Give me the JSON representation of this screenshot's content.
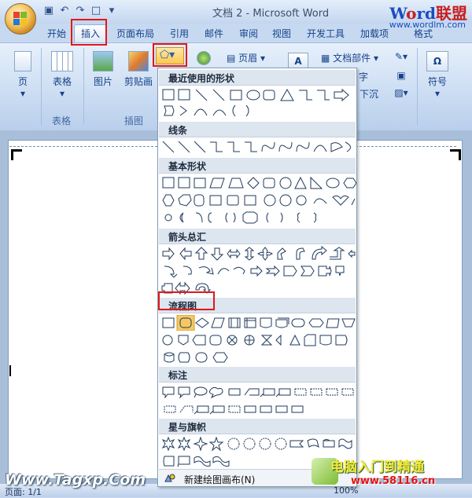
{
  "window": {
    "title": "文档 2 - Microsoft Word"
  },
  "qat": [
    "save-icon",
    "undo-icon",
    "redo-icon",
    "new-doc-icon",
    "customize-icon"
  ],
  "watermark_top": {
    "brand": "Word联盟",
    "brand_w": "W",
    "brand_o": "o",
    "brand_rd": "rd",
    "brand_cn": "联盟",
    "url": "www.wordlm.com"
  },
  "tabs": [
    "开始",
    "插入",
    "页面布局",
    "引用",
    "邮件",
    "审阅",
    "视图",
    "开发工具",
    "加载项",
    "格式"
  ],
  "ribbon": {
    "page_label": "页",
    "table_label": "表格",
    "table_group": "表格",
    "picture_label": "图片",
    "clipart_label": "剪贴画",
    "illus_group": "插图",
    "header_label": "页眉",
    "docparts_label": "文档部件",
    "char_label": "字",
    "sink_label": "下沉",
    "symbol_label": "符号"
  },
  "dropdown": {
    "sections": [
      "最近使用的形状",
      "线条",
      "基本形状",
      "箭头总汇",
      "流程图",
      "标注",
      "星与旗帜"
    ],
    "footer": "新建绘图画布(N)"
  },
  "status": {
    "page": "页面: 1/1",
    "zoom": "100%"
  },
  "watermarks": {
    "left": "Www.Tagxp.Com",
    "right_cn": "电脑入门到精通",
    "right_url": "www.58116.cn"
  },
  "colors": {
    "accent": "#15428b",
    "highlight": "#e01818",
    "selected_shape": "#f6c862"
  }
}
